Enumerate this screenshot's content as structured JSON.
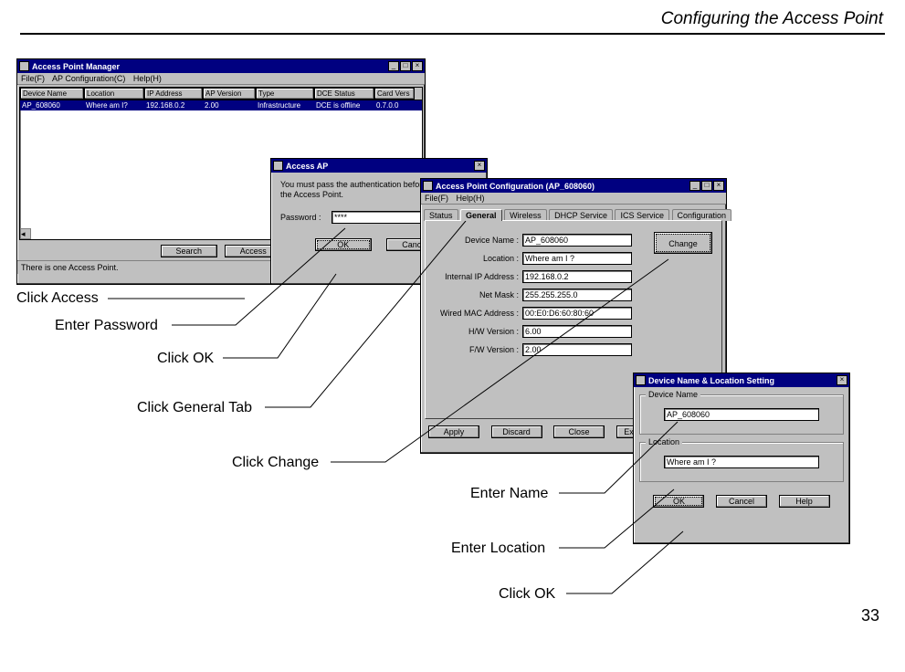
{
  "page": {
    "header": "Configuring the Access Point",
    "number": "33"
  },
  "apm": {
    "title": "Access Point Manager",
    "menu": {
      "file": "File(F)",
      "config": "AP Configuration(C)",
      "help": "Help(H)"
    },
    "columns": [
      "Device Name",
      "Location",
      "IP Address",
      "AP Version",
      "Type",
      "DCE Status",
      "Card Vers"
    ],
    "row": [
      "AP_608060",
      "Where am I?",
      "192.168.0.2",
      "2.00",
      "Infrastructure",
      "DCE is offline",
      "0.7.0.0"
    ],
    "buttons": {
      "search": "Search",
      "access": "Access"
    },
    "status": "There is one Access Point."
  },
  "accessAP": {
    "title": "Access AP",
    "message": "You must  pass the authentication before controlling the Access Point.",
    "passwordLabel": "Password :",
    "passwordValue": "****",
    "ok": "OK",
    "cancel": "Cancel"
  },
  "apc": {
    "title": "Access Point Configuration (AP_608060)",
    "menu": {
      "file": "File(F)",
      "help": "Help(H)"
    },
    "tabs": [
      "Status",
      "General",
      "Wireless",
      "DHCP Service",
      "ICS Service",
      "Configuration"
    ],
    "fields": {
      "deviceName": {
        "label": "Device Name :",
        "value": "AP_608060"
      },
      "location": {
        "label": "Location :",
        "value": "Where am I ?"
      },
      "internalIP": {
        "label": "Internal IP Address :",
        "value": "192.168.0.2"
      },
      "netMask": {
        "label": "Net Mask :",
        "value": "255.255.255.0"
      },
      "wiredMAC": {
        "label": "Wired MAC Address :",
        "value": "00:E0:D6:60:80:60"
      },
      "hwVersion": {
        "label": "H/W Version :",
        "value": "6.00"
      },
      "fwVersion": {
        "label": "F/W Version :",
        "value": "2.00"
      }
    },
    "change": "Change",
    "buttons": {
      "apply": "Apply",
      "discard": "Discard",
      "close": "Close",
      "exit": "Ex"
    }
  },
  "dnl": {
    "title": "Device Name & Location Setting",
    "nameCaption": "Device Name",
    "nameValue": "AP_608060",
    "locCaption": "Location",
    "locValue": "Where am I ?",
    "ok": "OK",
    "cancel": "Cancel",
    "help": "Help"
  },
  "callouts": {
    "clickAccess": "Click Access",
    "enterPassword": "Enter Password",
    "clickOK": "Click OK",
    "clickGeneralTab": "Click General Tab",
    "clickChange": "Click Change",
    "enterName": "Enter Name",
    "enterLocation": "Enter Location",
    "clickOK2": "Click OK"
  }
}
